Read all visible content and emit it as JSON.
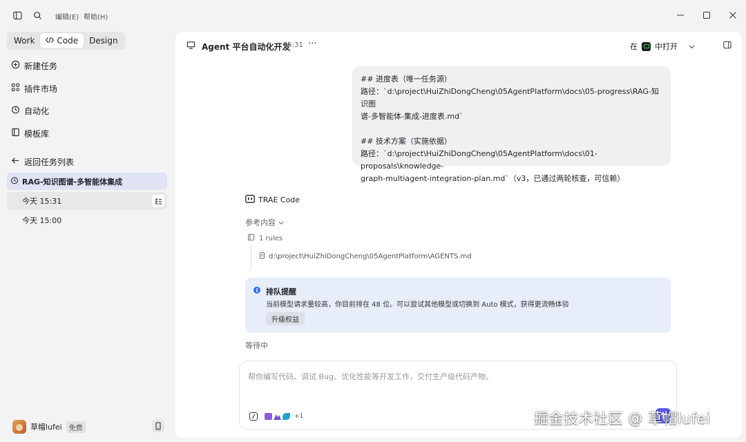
{
  "menu": {
    "edit": "编辑(E)",
    "help": "帮助(H)"
  },
  "modes": [
    {
      "label": "Work",
      "active": false
    },
    {
      "label": "Code",
      "active": true
    },
    {
      "label": "Design",
      "active": false
    }
  ],
  "nav": {
    "new_task": "新建任务",
    "plugin_market": "插件市场",
    "automation": "自动化",
    "templates": "模板库",
    "back_to_tasks": "返回任务列表"
  },
  "task": {
    "title": "RAG-知识图谱-多智能体集成",
    "runs": [
      {
        "label": "今天 15:31",
        "selected": true
      },
      {
        "label": "今天 15:00",
        "selected": false
      }
    ]
  },
  "user": {
    "name": "草帽lufei",
    "plan": "免费"
  },
  "header": {
    "title": "Agent 平台自动化开发",
    "time": "15:31",
    "more": "···",
    "open_prefix": "在",
    "open_label": "中打开"
  },
  "user_message": {
    "lines": [
      "## 进度表（唯一任务源）",
      "路径：`d:\\project\\HuiZhiDongCheng\\05AgentPlatform\\docs\\05-progress\\RAG-知识图",
      "谱-多智能体-集成-进度表.md`",
      "",
      "## 技术方案（实施依据）",
      "路径：`d:\\project\\HuiZhiDongCheng\\05AgentPlatform\\docs\\01-proposals\\knowledge-",
      "graph-multiagent-integration-plan.md`（v3，已通过两轮核查，可信赖）"
    ]
  },
  "agent": {
    "name": "TRAE Code",
    "ref_label": "参考内容",
    "rules_count": "1 rules",
    "rule_path": "d:\\project\\HuiZhiDongCheng\\05AgentPlatform\\AGENTS.md"
  },
  "notice": {
    "title": "排队提醒",
    "text": "当前模型请求量较高，你目前排在 48 位。可以尝试其他模型或切换到 Auto 模式，获得更流畅体验",
    "button": "升级权益"
  },
  "status": {
    "waiting": "等待中"
  },
  "input": {
    "placeholder": "帮你编写代码、调试 Bug、优化性能等开发工作，交付生产级代码产物。",
    "plugins_more": "+1"
  },
  "watermark": "掘金技术社区 @ 草帽lufei",
  "colors": {
    "accent": "#3370ff",
    "send": "#5b5be6",
    "notice_bg": "#e8edfa",
    "task_active_bg": "#dfe3f4"
  }
}
